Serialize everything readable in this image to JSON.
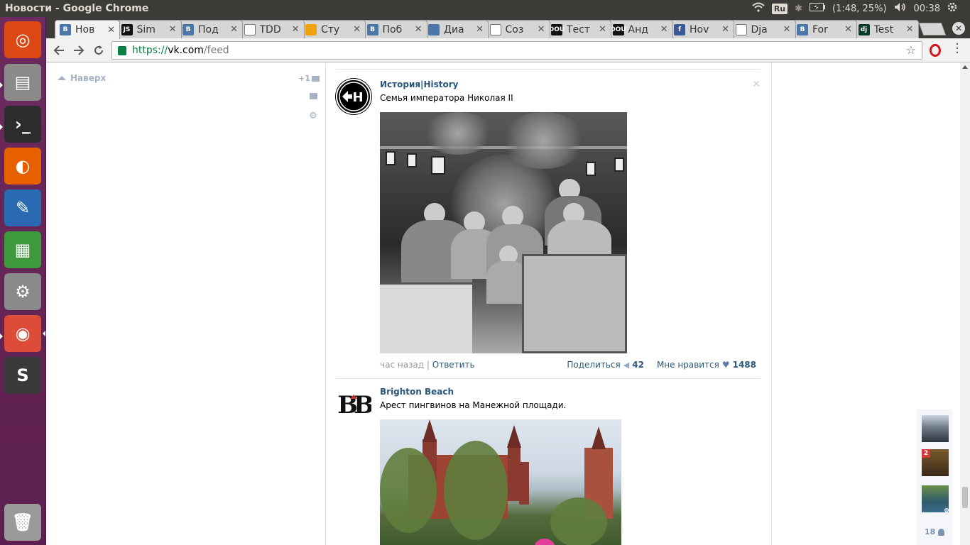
{
  "window": {
    "title": "Новости - Google Chrome"
  },
  "indicators": {
    "keyboard": "Ru",
    "battery": "(1:48, 25%)",
    "clock": "00:38"
  },
  "launcher": [
    {
      "name": "ubuntu-dash-icon",
      "color": "#dd4814"
    },
    {
      "name": "files-icon",
      "color": "#8a8a8a"
    },
    {
      "name": "terminal-icon",
      "color": "#2c2c2c"
    },
    {
      "name": "firefox-icon",
      "color": "#e66000"
    },
    {
      "name": "writer-icon",
      "color": "#2a6ab3"
    },
    {
      "name": "calc-icon",
      "color": "#3d9a3d"
    },
    {
      "name": "system-settings-icon",
      "color": "#8a8a8a"
    },
    {
      "name": "chrome-icon",
      "color": "#dd4b39"
    },
    {
      "name": "sublime-text-icon",
      "color": "#3a3a3a"
    },
    {
      "name": "trash-icon",
      "color": "#9a9a9a"
    }
  ],
  "tabs": [
    {
      "label": "Нов",
      "fav": "В",
      "fav_color": "#4a76a8",
      "active": true
    },
    {
      "label": "Sim",
      "fav": "JS",
      "fav_color": "#111111"
    },
    {
      "label": "Под",
      "fav": "В",
      "fav_color": "#4a76a8"
    },
    {
      "label": "TDD",
      "fav": "",
      "fav_color": "#ffffff"
    },
    {
      "label": "Сту",
      "fav": "",
      "fav_color": "#f2a20c"
    },
    {
      "label": "Поб",
      "fav": "В",
      "fav_color": "#4a76a8"
    },
    {
      "label": "Диа",
      "fav": "",
      "fav_color": "#4a76a8"
    },
    {
      "label": "Соз",
      "fav": "",
      "fav_color": "#ffffff"
    },
    {
      "label": "Тест",
      "fav": "DOU",
      "fav_color": "#111111"
    },
    {
      "label": "Анд",
      "fav": "DOU",
      "fav_color": "#111111"
    },
    {
      "label": "Hov",
      "fav": "f",
      "fav_color": "#3b5998"
    },
    {
      "label": "Dja",
      "fav": "",
      "fav_color": "#ffffff"
    },
    {
      "label": "For",
      "fav": "В",
      "fav_color": "#4a76a8"
    },
    {
      "label": "Test",
      "fav": "dj",
      "fav_color": "#0c3c26"
    }
  ],
  "toolbar": {
    "url_scheme": "https://",
    "url_host": "vk.com",
    "url_path": "/feed"
  },
  "left": {
    "up_label": "Наверх",
    "plus_label": "+1"
  },
  "posts": [
    {
      "author": "История|History",
      "avatar_text": "H",
      "text": "Семья императора Николая II",
      "time": "час назад",
      "reply": "Ответить",
      "share_label": "Поделиться",
      "share_count": "42",
      "like_label": "Мне нравится",
      "like_count": "1488"
    },
    {
      "author": "Brighton Beach",
      "avatar_text": "BB",
      "text": "Арест пингвинов на Манежной площади."
    }
  ],
  "friends": {
    "badge_count": "2",
    "online_count": "18"
  }
}
